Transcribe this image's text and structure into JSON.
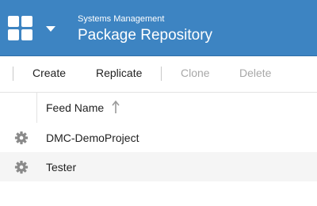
{
  "header": {
    "subtitle": "Systems Management",
    "title": "Package Repository",
    "background_color": "#3d84c2",
    "app_menu_icon": "app-grid-icon",
    "dropdown_icon": "caret-down-icon"
  },
  "toolbar": {
    "create_label": "Create",
    "replicate_label": "Replicate",
    "clone_label": "Clone",
    "delete_label": "Delete"
  },
  "grid": {
    "column_header": "Feed Name",
    "sort_icon": "sort-ascending-arrow-icon",
    "row_icon": "gear-icon",
    "rows": [
      {
        "feed_name": "DMC-DemoProject"
      },
      {
        "feed_name": "Tester"
      }
    ]
  }
}
